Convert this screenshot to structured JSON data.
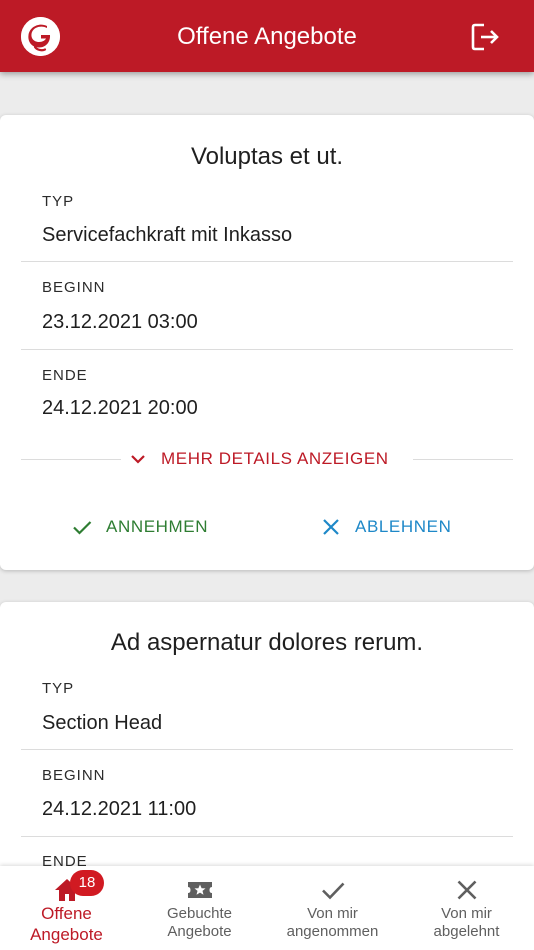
{
  "app": {
    "title": "Offene Angebote",
    "logo_icon": "brand-logo",
    "logout_icon": "logout-icon",
    "brand_color": "#bd1a26"
  },
  "offers": [
    {
      "title": "Voluptas et ut.",
      "fields": [
        {
          "label": "TYP",
          "value": "Servicefachkraft mit Inkasso"
        },
        {
          "label": "BEGINN",
          "value": "23.12.2021 03:00"
        },
        {
          "label": "ENDE",
          "value": "24.12.2021 20:00"
        }
      ],
      "details_label": "MEHR DETAILS ANZEIGEN",
      "accept_label": "ANNEHMEN",
      "reject_label": "ABLEHNEN"
    },
    {
      "title": "Ad aspernatur dolores rerum.",
      "fields": [
        {
          "label": "TYP",
          "value": "Section Head"
        },
        {
          "label": "BEGINN",
          "value": "24.12.2021 11:00"
        },
        {
          "label": "ENDE",
          "value": ""
        }
      ]
    }
  ],
  "bottom_nav": [
    {
      "line1": "Offene",
      "line2": "Angebote",
      "icon": "home-icon",
      "badge": "18",
      "active": true
    },
    {
      "line1": "Gebuchte",
      "line2": "Angebote",
      "icon": "ticket-star-icon",
      "active": false
    },
    {
      "line1": "Von mir",
      "line2": "angenommen",
      "icon": "check-icon",
      "active": false
    },
    {
      "line1": "Von mir",
      "line2": "abgelehnt",
      "icon": "close-icon",
      "active": false
    }
  ]
}
